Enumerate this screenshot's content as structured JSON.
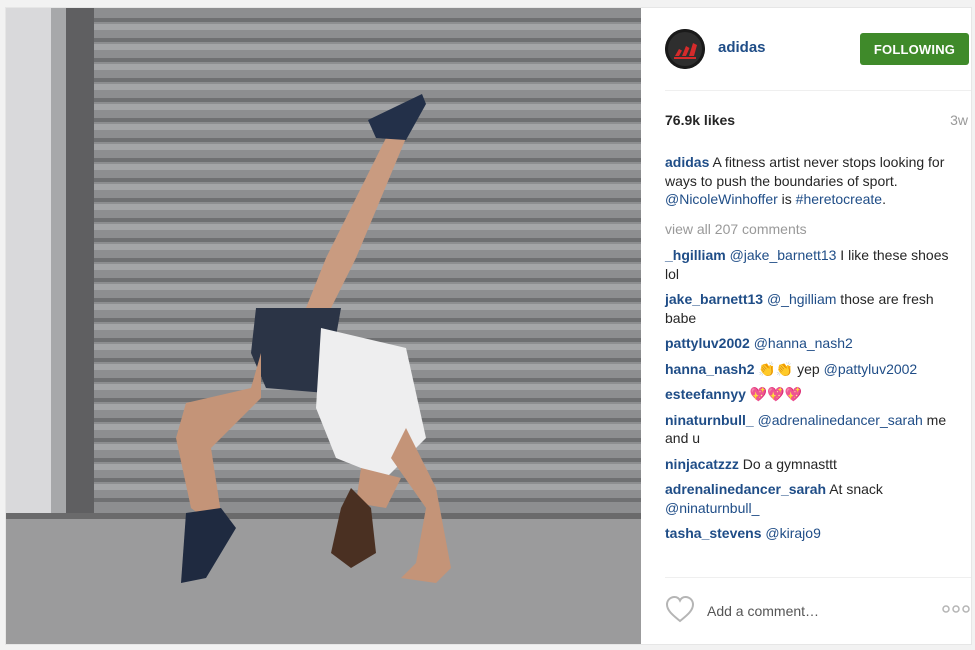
{
  "header": {
    "username": "adidas",
    "follow_label": "FOLLOWING"
  },
  "stats": {
    "likes": "76.9k likes",
    "time": "3w"
  },
  "caption": {
    "user": "adidas",
    "text1": " A fitness artist never stops looking for ways to push the boundaries of sport. ",
    "mention": "@NicoleWinhoffer",
    "text2": " is ",
    "hashtag": "#heretocreate",
    "text3": "."
  },
  "view_all": "view all 207 comments",
  "comments": [
    {
      "user": "_hgilliam",
      "mention": "@jake_barnett13",
      "text": " I like these shoes lol"
    },
    {
      "user": "jake_barnett13",
      "mention": "@_hgilliam",
      "text": " those are fresh babe"
    },
    {
      "user": "pattyluv2002",
      "mention": "@hanna_nash2",
      "text": ""
    },
    {
      "user": "hanna_nash2",
      "emoji": "👏👏",
      "text": " yep ",
      "mention": "@pattyluv2002"
    },
    {
      "user": "esteefannyy",
      "emoji": "💖💖💖"
    },
    {
      "user": "ninaturnbull_",
      "mention": "@adrenalinedancer_sarah",
      "text": " me and u"
    },
    {
      "user": "ninjacatzzz",
      "text": " Do a gymnasttt"
    },
    {
      "user": "adrenalinedancer_sarah",
      "text": " At snack ",
      "mention": "@ninaturnbull_"
    },
    {
      "user": "tasha_stevens",
      "mention": "@kirajo9",
      "text": ""
    }
  ],
  "footer": {
    "placeholder": "Add a comment…"
  },
  "colors": {
    "link": "#1f4d87",
    "follow_green": "#3f8a2a",
    "muted": "#999999"
  },
  "icons": {
    "like": "heart-outline-icon",
    "more": "more-dots-icon",
    "avatar": "adidas-logo"
  }
}
